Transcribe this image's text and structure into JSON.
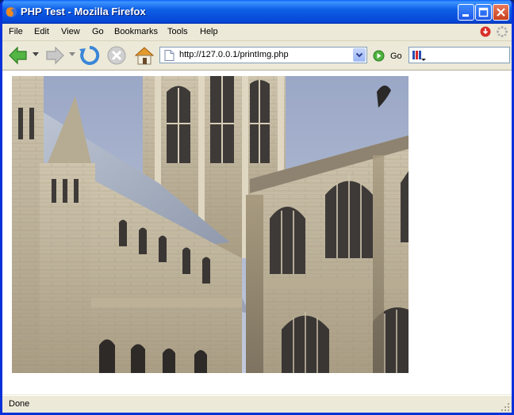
{
  "window": {
    "title": "PHP Test - Mozilla Firefox"
  },
  "menubar": {
    "items": [
      "File",
      "Edit",
      "View",
      "Go",
      "Bookmarks",
      "Tools",
      "Help"
    ]
  },
  "toolbar": {
    "back_icon": "back-arrow-icon",
    "forward_icon": "forward-arrow-icon",
    "reload_icon": "reload-icon",
    "stop_icon": "stop-icon",
    "home_icon": "home-icon",
    "go_label": "Go"
  },
  "address": {
    "url": "http://127.0.0.1/printImg.php"
  },
  "content": {
    "image_subject": "gothic cathedral photograph"
  },
  "status": {
    "text": "Done"
  }
}
